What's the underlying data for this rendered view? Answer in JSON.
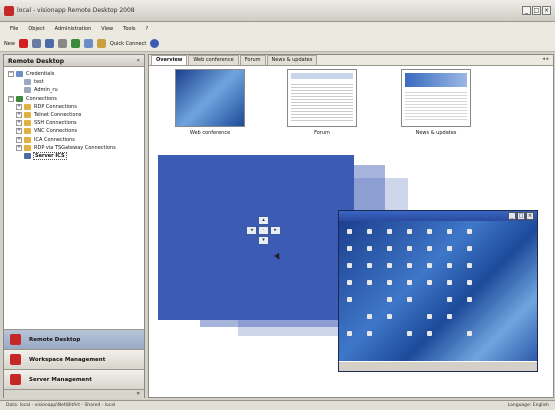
{
  "window": {
    "title": "local - visionapp Remote Desktop 2008",
    "controls": [
      "_",
      "□",
      "×"
    ]
  },
  "menu": [
    "File",
    "Object",
    "Administration",
    "View",
    "Tools",
    "?"
  ],
  "toolbar": {
    "new_label": "New",
    "quick_connect_label": "Quick Connect"
  },
  "left_panel": {
    "title": "Remote Desktop",
    "collapse": "«",
    "tree": [
      {
        "label": "Credentials",
        "level": 0,
        "expander": "−",
        "icon": "#6a8fc8"
      },
      {
        "label": "test",
        "level": 1,
        "expander": "",
        "icon": "#9aa8c0"
      },
      {
        "label": "Admin_ru",
        "level": 1,
        "expander": "",
        "icon": "#9aa8c0"
      },
      {
        "label": "Connections",
        "level": 0,
        "expander": "−",
        "icon": "#3a8a3a"
      },
      {
        "label": "RDP Connections",
        "level": 1,
        "expander": "+",
        "icon": "#e0b040"
      },
      {
        "label": "Telnet Connections",
        "level": 1,
        "expander": "+",
        "icon": "#e0b040"
      },
      {
        "label": "SSH Connections",
        "level": 1,
        "expander": "+",
        "icon": "#e0b040"
      },
      {
        "label": "VNC Connections",
        "level": 1,
        "expander": "+",
        "icon": "#e0b040"
      },
      {
        "label": "ICA Connections",
        "level": 1,
        "expander": "+",
        "icon": "#e0b040"
      },
      {
        "label": "RDP via TSGateway Connections",
        "level": 1,
        "expander": "+",
        "icon": "#e0b040"
      },
      {
        "label": "Server ICS",
        "level": 1,
        "expander": "",
        "icon": "#4a6aa8",
        "selected": true
      }
    ],
    "buttons": [
      {
        "label": "Remote Desktop",
        "icon": "#c62828",
        "active": true
      },
      {
        "label": "Workspace Management",
        "icon": "#c62828",
        "active": false
      },
      {
        "label": "Server Management",
        "icon": "#c62828",
        "active": false
      }
    ],
    "bottom_arrow": "»"
  },
  "right_panel": {
    "tabs": [
      {
        "label": "Overview",
        "active": true
      },
      {
        "label": "Web conference",
        "active": false
      },
      {
        "label": "Forum",
        "active": false
      },
      {
        "label": "News & updates",
        "active": false
      }
    ],
    "tab_arrows": "◂ ▸",
    "thumbnails": [
      {
        "label": "Web conference"
      },
      {
        "label": "Forum"
      },
      {
        "label": "News & updates"
      }
    ],
    "nav_keys": {
      "up": "▴",
      "left": "◂",
      "center": "·",
      "right": "▸",
      "down": "▾"
    },
    "remote_window_controls": [
      "_",
      "□",
      "×"
    ]
  },
  "status_bar": {
    "left": "Data: local - visionapp\\Net\\BitArt - Shared - local",
    "right": "Language: English"
  },
  "colors": {
    "accent_blue": "#3b5bb4",
    "brand_red": "#c62828"
  }
}
